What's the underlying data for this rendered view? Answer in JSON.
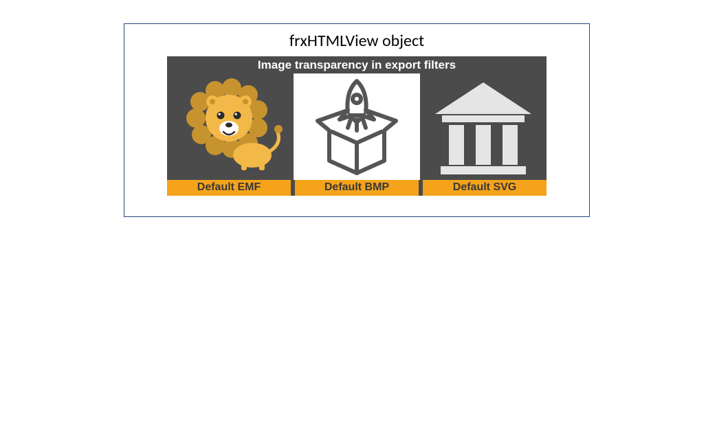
{
  "title": "frxHTMLView object",
  "panel": {
    "heading": "Image transparency in export filters",
    "cells": [
      {
        "label": "Default EMF",
        "icon": "lion-icon"
      },
      {
        "label": "Default BMP",
        "icon": "rocket-box-icon"
      },
      {
        "label": "Default SVG",
        "icon": "bank-icon"
      }
    ]
  },
  "colors": {
    "border": "#1f497d",
    "panelBg": "#4b4b4b",
    "labelBg": "#f5a31b",
    "lionMane": "#c7932f",
    "lionFace": "#f3b948",
    "iconGray": "#555555",
    "iconLight": "#e5e5e5"
  }
}
